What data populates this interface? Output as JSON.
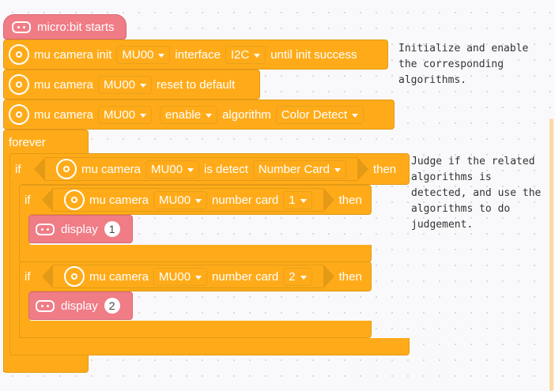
{
  "hat": {
    "label": "micro:bit starts"
  },
  "init": {
    "prefix": "mu camera init",
    "device": "MU00",
    "mid": "interface",
    "iface": "I2C",
    "suffix": "until init success"
  },
  "reset": {
    "prefix": "mu camera",
    "device": "MU00",
    "suffix": "reset to default"
  },
  "enable": {
    "prefix": "mu camera",
    "device": "MU00",
    "mode": "enable",
    "mid": "algorithm",
    "algo": "Color Detect"
  },
  "forever": {
    "label": "forever"
  },
  "if_outer": {
    "kw": "if",
    "prefix": "mu camera",
    "device": "MU00",
    "mid": "is detect",
    "algo": "Number Card",
    "then": "then"
  },
  "if1": {
    "kw": "if",
    "prefix": "mu camera",
    "device": "MU00",
    "mid": "number card",
    "value": "1",
    "then": "then"
  },
  "display1": {
    "label": "display",
    "value": "1"
  },
  "if2": {
    "kw": "if",
    "prefix": "mu camera",
    "device": "MU00",
    "mid": "number card",
    "value": "2",
    "then": "then"
  },
  "display2": {
    "label": "display",
    "value": "2"
  },
  "comments": {
    "c1": "Initialize and enable\nthe corresponding\nalgorithms.",
    "c2": "Judge if the related\nalgorithms is\ndetected, and use the\nalgorithms to do\njudgement."
  },
  "colors": {
    "control": "#ffab19",
    "basic": "#f07c86",
    "background": "#f9f9fb"
  },
  "icons": {
    "camera": "camera-icon",
    "microbit": "microbit-icon",
    "dropdown": "dropdown-arrow-icon"
  }
}
